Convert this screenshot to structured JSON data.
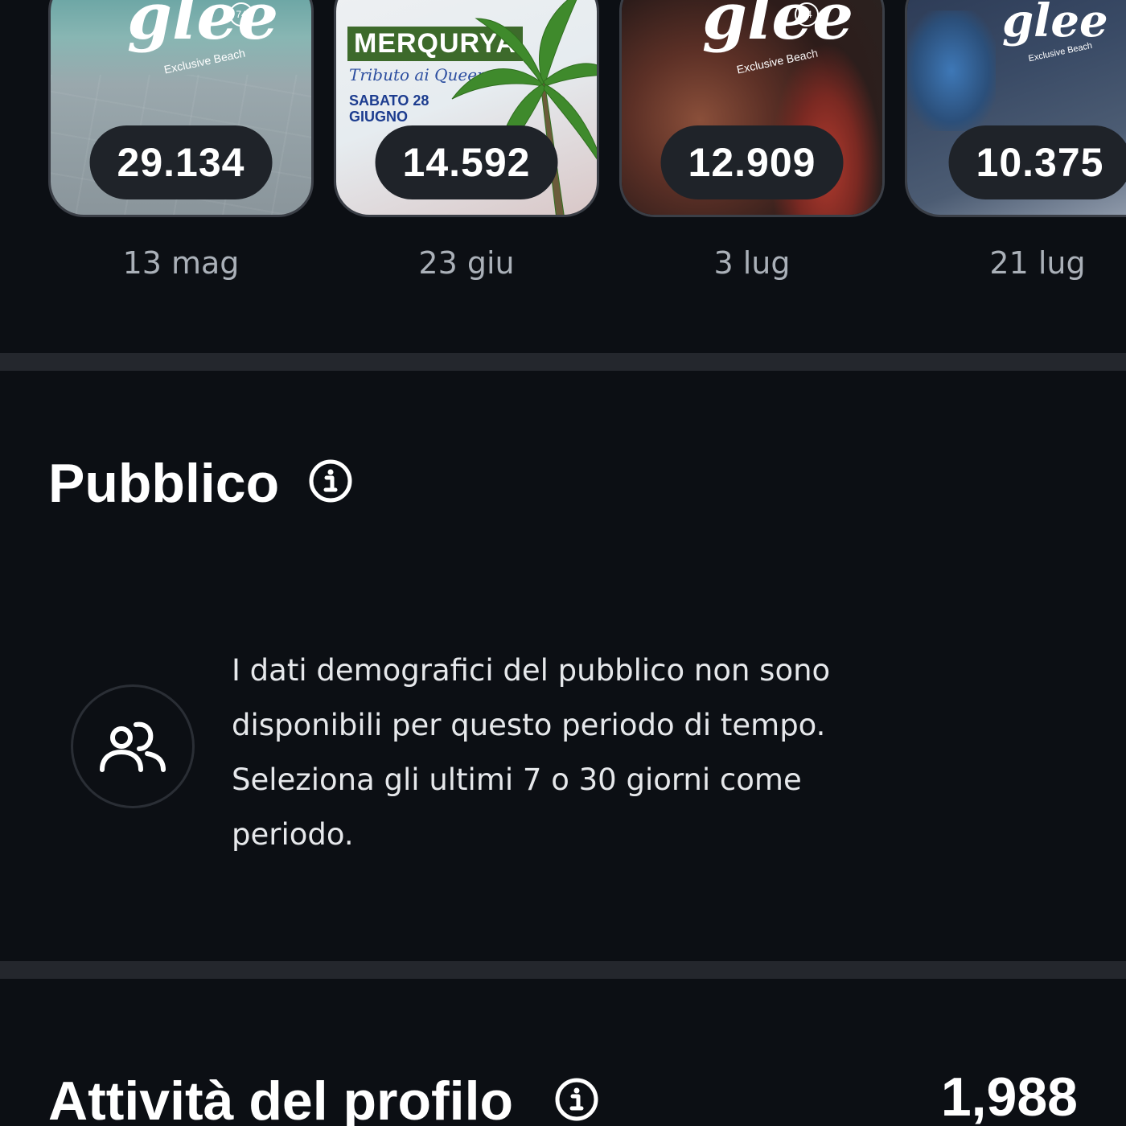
{
  "reels": [
    {
      "count": "29.134",
      "date": "13 mag",
      "logo_text": "glee",
      "logo_sub": "Exclusive Beach",
      "logo_badge": "74"
    },
    {
      "count": "14.592",
      "date": "23 giu",
      "banner_title": "MERQURYA",
      "banner_subtitle": "Tributo ai Queen",
      "banner_date_line1": "SABATO 28",
      "banner_date_line2": "GIUGNO"
    },
    {
      "count": "12.909",
      "date": "3 lug",
      "logo_text": "glee",
      "logo_sub": "Exclusive Beach",
      "logo_badge": "74"
    },
    {
      "count": "10.375",
      "date": "21 lug",
      "logo_text": "glee",
      "logo_sub": "Exclusive Beach"
    }
  ],
  "audience": {
    "title": "Pubblico",
    "info_icon": "info-icon",
    "icon": "people-icon",
    "message": "I dati demografici del pubblico non sono disponibili per questo periodo di tempo. Seleziona gli ultimi 7 o 30 giorni come periodo."
  },
  "profile_activity": {
    "title": "Attività del profilo",
    "info_icon": "info-icon",
    "value": "1,988"
  },
  "colors": {
    "background": "#0c0f14",
    "divider": "#24272d",
    "pill": "#1f2329",
    "date_text": "#aab0b8",
    "body_text": "#e6e8eb"
  }
}
